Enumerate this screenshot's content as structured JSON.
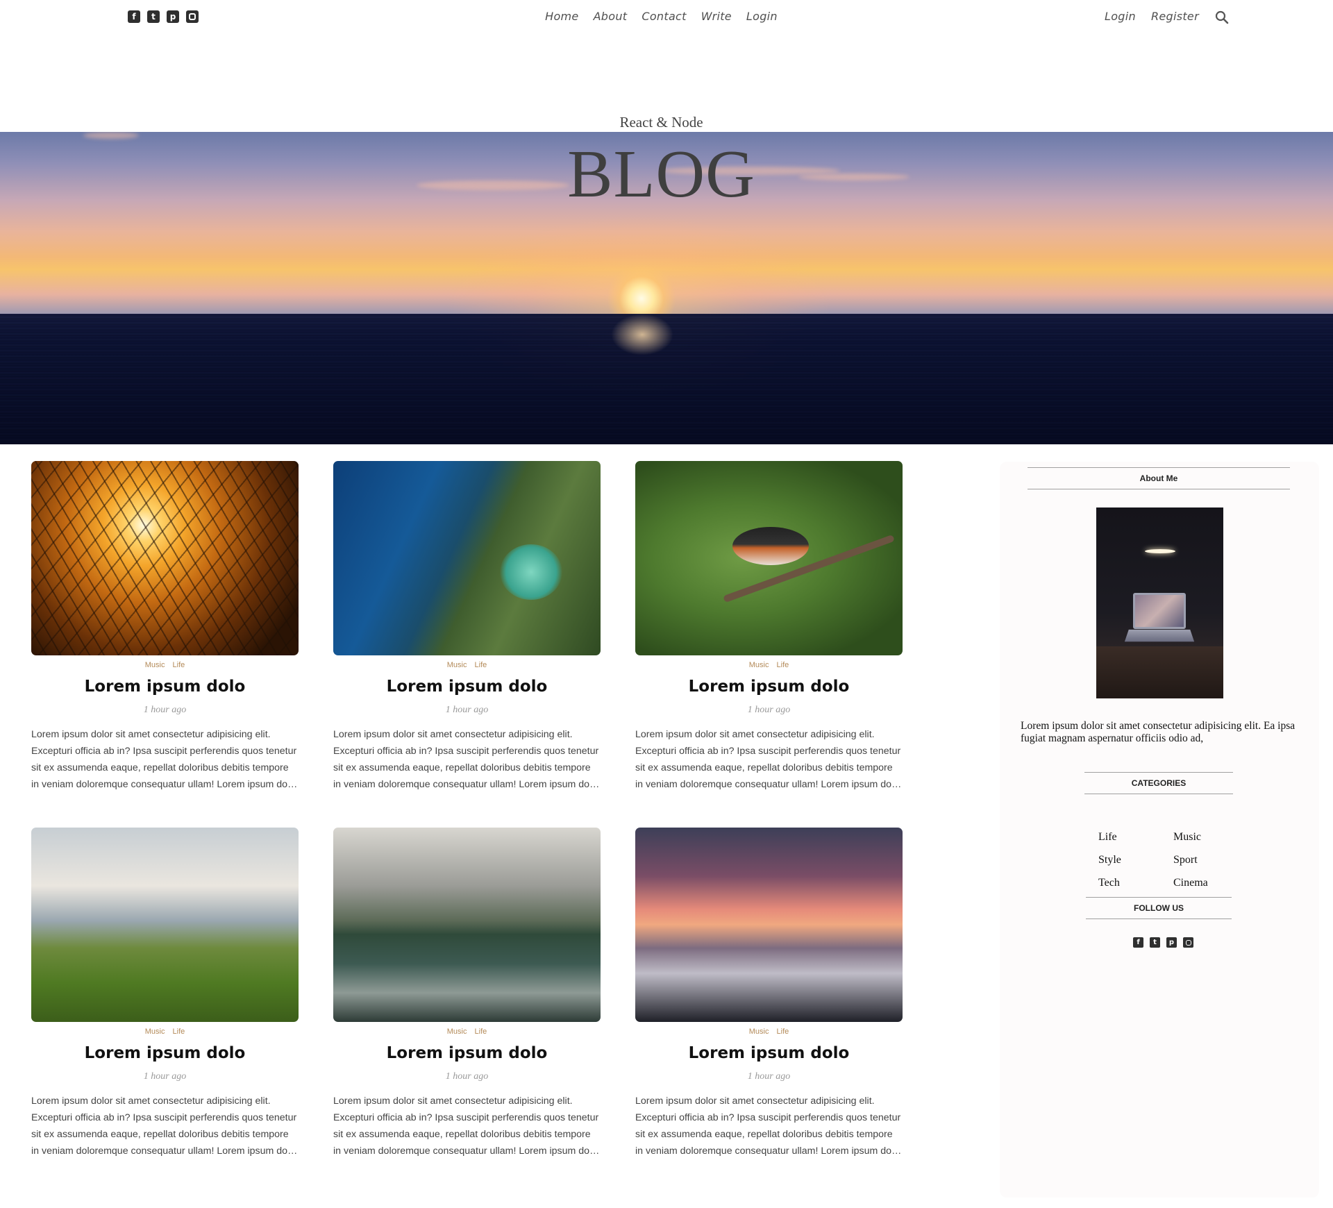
{
  "nav": {
    "social_icons": [
      "facebook-icon",
      "twitter-icon",
      "pinterest-icon",
      "instagram-icon"
    ],
    "links": [
      "Home",
      "About",
      "Contact",
      "Write",
      "Login"
    ],
    "auth": [
      "Login",
      "Register"
    ],
    "search_icon": "search-icon"
  },
  "header": {
    "subtitle": "React & Node",
    "title": "BLOG"
  },
  "posts": [
    {
      "cats": [
        "Music",
        "Life"
      ],
      "title": "Lorem ipsum dolo",
      "date": "1 hour ago",
      "desc": "Lorem ipsum dolor sit amet consectetur adipisicing elit. Excepturi officia ab in? Ipsa suscipit perferendis quos tenetur sit ex assumenda eaque, repellat doloribus debitis tempore in veniam doloremque consequatur ullam! Lorem ipsum dolor sit amet"
    },
    {
      "cats": [
        "Music",
        "Life"
      ],
      "title": "Lorem ipsum dolo",
      "date": "1 hour ago",
      "desc": "Lorem ipsum dolor sit amet consectetur adipisicing elit. Excepturi officia ab in? Ipsa suscipit perferendis quos tenetur sit ex assumenda eaque, repellat doloribus debitis tempore in veniam doloremque consequatur ullam! Lorem ipsum dolor sit amet"
    },
    {
      "cats": [
        "Music",
        "Life"
      ],
      "title": "Lorem ipsum dolo",
      "date": "1 hour ago",
      "desc": "Lorem ipsum dolor sit amet consectetur adipisicing elit. Excepturi officia ab in? Ipsa suscipit perferendis quos tenetur sit ex assumenda eaque, repellat doloribus debitis tempore in veniam doloremque consequatur ullam! Lorem ipsum dolor sit amet"
    },
    {
      "cats": [
        "Music",
        "Life"
      ],
      "title": "Lorem ipsum dolo",
      "date": "1 hour ago",
      "desc": "Lorem ipsum dolor sit amet consectetur adipisicing elit. Excepturi officia ab in? Ipsa suscipit perferendis quos tenetur sit ex assumenda eaque, repellat doloribus debitis tempore in veniam doloremque consequatur ullam! Lorem ipsum dolor sit amet"
    },
    {
      "cats": [
        "Music",
        "Life"
      ],
      "title": "Lorem ipsum dolo",
      "date": "1 hour ago",
      "desc": "Lorem ipsum dolor sit amet consectetur adipisicing elit. Excepturi officia ab in? Ipsa suscipit perferendis quos tenetur sit ex assumenda eaque, repellat doloribus debitis tempore in veniam doloremque consequatur ullam! Lorem ipsum dolor sit amet"
    },
    {
      "cats": [
        "Music",
        "Life"
      ],
      "title": "Lorem ipsum dolo",
      "date": "1 hour ago",
      "desc": "Lorem ipsum dolor sit amet consectetur adipisicing elit. Excepturi officia ab in? Ipsa suscipit perferendis quos tenetur sit ex assumenda eaque, repellat doloribus debitis tempore in veniam doloremque consequatur ullam! Lorem ipsum dolor sit amet"
    }
  ],
  "sidebar": {
    "about_title": "About Me",
    "about_text": "Lorem ipsum dolor sit amet consectetur adipisicing elit. Ea ipsa fugiat magnam aspernatur officiis odio ad,",
    "categories_title": "CATEGORIES",
    "categories": [
      "Life",
      "Music",
      "Style",
      "Sport",
      "Tech",
      "Cinema"
    ],
    "follow_title": "FOLLOW US",
    "social_icons": [
      "facebook-icon",
      "twitter-icon",
      "pinterest-icon",
      "instagram-icon"
    ]
  },
  "colors": {
    "category_accent": "#b38a58",
    "text_dark": "#111111",
    "date_gray": "#999999"
  }
}
